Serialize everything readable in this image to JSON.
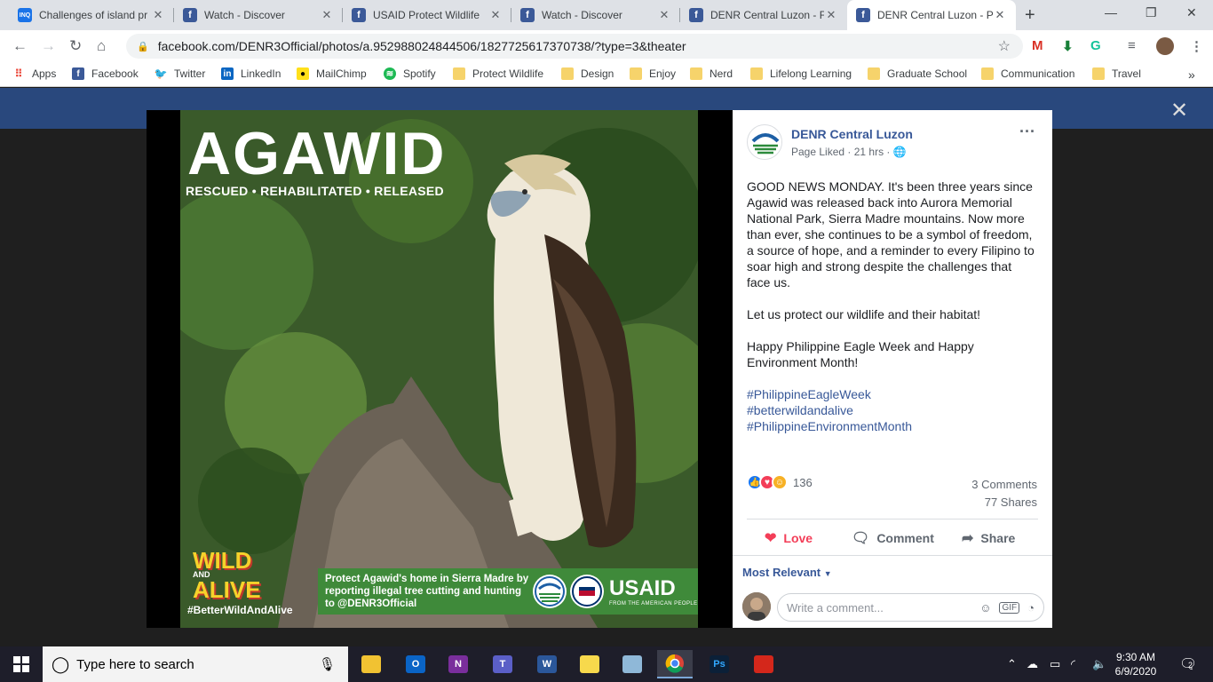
{
  "browser": {
    "tabs": [
      {
        "title": "Challenges of island pr",
        "favicon": "INQ",
        "color": "#1a73e8"
      },
      {
        "title": "Watch - Discover",
        "favicon": "f",
        "color": "#3b5998"
      },
      {
        "title": "USAID Protect Wildlife",
        "favicon": "f",
        "color": "#3b5998"
      },
      {
        "title": "Watch - Discover",
        "favicon": "f",
        "color": "#3b5998"
      },
      {
        "title": "DENR Central Luzon - F",
        "favicon": "f",
        "color": "#3b5998"
      },
      {
        "title": "DENR Central Luzon - P",
        "favicon": "f",
        "color": "#3b5998"
      }
    ],
    "active_tab": 5,
    "new_tab_label": "+",
    "url": "facebook.com/DENR3Official/photos/a.952988024844506/1827725617370738/?type=3&theater",
    "bookmarks": [
      {
        "label": "Apps",
        "icon": "apps-grid-icon"
      },
      {
        "label": "Facebook",
        "icon": "facebook-icon"
      },
      {
        "label": "Twitter",
        "icon": "twitter-icon"
      },
      {
        "label": "LinkedIn",
        "icon": "linkedin-icon"
      },
      {
        "label": "MailChimp",
        "icon": "mailchimp-icon"
      },
      {
        "label": "Spotify",
        "icon": "spotify-icon"
      },
      {
        "label": "Protect Wildlife",
        "icon": "folder-icon"
      },
      {
        "label": "Design",
        "icon": "folder-icon"
      },
      {
        "label": "Enjoy",
        "icon": "folder-icon"
      },
      {
        "label": "Nerd",
        "icon": "folder-icon"
      },
      {
        "label": "Lifelong Learning",
        "icon": "folder-icon"
      },
      {
        "label": "Graduate School",
        "icon": "folder-icon"
      },
      {
        "label": "Communication",
        "icon": "folder-icon"
      },
      {
        "label": "Travel",
        "icon": "folder-icon"
      }
    ],
    "bookmarks_overflow": "»"
  },
  "photo": {
    "headline": "AGAWID",
    "subhead": "RESCUED • REHABILITATED • RELEASED",
    "badge_top": "WILD",
    "badge_mid": "AND",
    "badge_bottom": "ALIVE",
    "hashtag": "#BetterWildAndAlive",
    "message": "Protect Agawid's home in Sierra Madre by reporting illegal tree cutting and hunting to @DENR3Official",
    "partner": "USAID",
    "partner_tagline": "FROM THE AMERICAN PEOPLE"
  },
  "post": {
    "page_name": "DENR Central Luzon",
    "meta": "Page Liked · 21 hrs · ",
    "paragraphs": [
      "GOOD NEWS MONDAY. It's been three years since Agawid was released back into Aurora Memorial National Park, Sierra Madre mountains. Now more than ever, she continues to be a symbol of freedom, a source of hope, and a reminder to every Filipino to soar high and strong despite the challenges that face us.",
      "Let us protect our wildlife and their habitat!",
      "Happy Philippine Eagle Week and Happy Environment Month!"
    ],
    "hashtags": [
      "#PhilippineEagleWeek",
      "#betterwildandalive",
      "#PhilippineEnvironmentMonth"
    ],
    "reaction_count": "136",
    "comments": "3 Comments",
    "shares": "77 Shares",
    "actions": {
      "love": "Love",
      "comment": "Comment",
      "share": "Share"
    },
    "sort_label": "Most Relevant",
    "comment_placeholder": "Write a comment...",
    "comment_icons": [
      "emoji-icon",
      "gif-icon",
      "sticker-icon"
    ]
  },
  "taskbar": {
    "search_placeholder": "Type here to search",
    "apps": [
      {
        "name": "file-explorer",
        "label": "",
        "color": "#f1c232"
      },
      {
        "name": "outlook",
        "label": "O",
        "color": "#0a64c6"
      },
      {
        "name": "onenote",
        "label": "N",
        "color": "#7a2e9c"
      },
      {
        "name": "teams",
        "label": "T",
        "color": "#5b5fc7"
      },
      {
        "name": "word",
        "label": "W",
        "color": "#2b579a"
      },
      {
        "name": "sticky-notes",
        "label": "",
        "color": "#f7d94c"
      },
      {
        "name": "editor",
        "label": "",
        "color": "#8fb8d8"
      },
      {
        "name": "chrome",
        "label": "",
        "color": "#db4437"
      },
      {
        "name": "photoshop",
        "label": "Ps",
        "color": "#0b2038"
      },
      {
        "name": "acrobat",
        "label": "",
        "color": "#d4271b"
      }
    ],
    "time": "9:30 AM",
    "date": "6/9/2020",
    "notification_count": "2"
  }
}
